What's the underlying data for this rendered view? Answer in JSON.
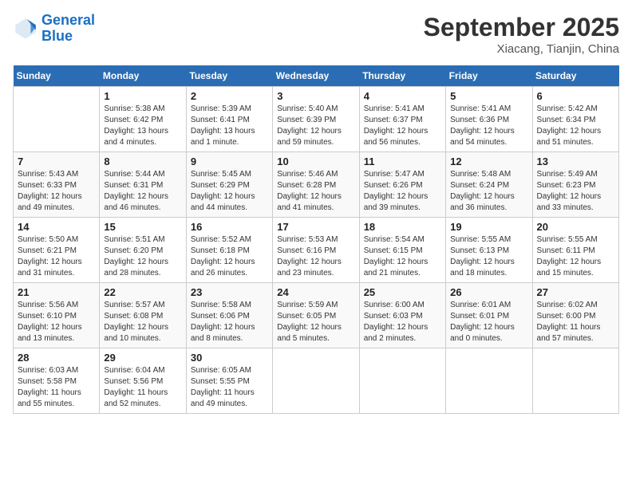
{
  "header": {
    "logo_line1": "General",
    "logo_line2": "Blue",
    "month_title": "September 2025",
    "location": "Xiacang, Tianjin, China"
  },
  "days_of_week": [
    "Sunday",
    "Monday",
    "Tuesday",
    "Wednesday",
    "Thursday",
    "Friday",
    "Saturday"
  ],
  "weeks": [
    [
      {
        "num": "",
        "info": ""
      },
      {
        "num": "1",
        "info": "Sunrise: 5:38 AM\nSunset: 6:42 PM\nDaylight: 13 hours\nand 4 minutes."
      },
      {
        "num": "2",
        "info": "Sunrise: 5:39 AM\nSunset: 6:41 PM\nDaylight: 13 hours\nand 1 minute."
      },
      {
        "num": "3",
        "info": "Sunrise: 5:40 AM\nSunset: 6:39 PM\nDaylight: 12 hours\nand 59 minutes."
      },
      {
        "num": "4",
        "info": "Sunrise: 5:41 AM\nSunset: 6:37 PM\nDaylight: 12 hours\nand 56 minutes."
      },
      {
        "num": "5",
        "info": "Sunrise: 5:41 AM\nSunset: 6:36 PM\nDaylight: 12 hours\nand 54 minutes."
      },
      {
        "num": "6",
        "info": "Sunrise: 5:42 AM\nSunset: 6:34 PM\nDaylight: 12 hours\nand 51 minutes."
      }
    ],
    [
      {
        "num": "7",
        "info": "Sunrise: 5:43 AM\nSunset: 6:33 PM\nDaylight: 12 hours\nand 49 minutes."
      },
      {
        "num": "8",
        "info": "Sunrise: 5:44 AM\nSunset: 6:31 PM\nDaylight: 12 hours\nand 46 minutes."
      },
      {
        "num": "9",
        "info": "Sunrise: 5:45 AM\nSunset: 6:29 PM\nDaylight: 12 hours\nand 44 minutes."
      },
      {
        "num": "10",
        "info": "Sunrise: 5:46 AM\nSunset: 6:28 PM\nDaylight: 12 hours\nand 41 minutes."
      },
      {
        "num": "11",
        "info": "Sunrise: 5:47 AM\nSunset: 6:26 PM\nDaylight: 12 hours\nand 39 minutes."
      },
      {
        "num": "12",
        "info": "Sunrise: 5:48 AM\nSunset: 6:24 PM\nDaylight: 12 hours\nand 36 minutes."
      },
      {
        "num": "13",
        "info": "Sunrise: 5:49 AM\nSunset: 6:23 PM\nDaylight: 12 hours\nand 33 minutes."
      }
    ],
    [
      {
        "num": "14",
        "info": "Sunrise: 5:50 AM\nSunset: 6:21 PM\nDaylight: 12 hours\nand 31 minutes."
      },
      {
        "num": "15",
        "info": "Sunrise: 5:51 AM\nSunset: 6:20 PM\nDaylight: 12 hours\nand 28 minutes."
      },
      {
        "num": "16",
        "info": "Sunrise: 5:52 AM\nSunset: 6:18 PM\nDaylight: 12 hours\nand 26 minutes."
      },
      {
        "num": "17",
        "info": "Sunrise: 5:53 AM\nSunset: 6:16 PM\nDaylight: 12 hours\nand 23 minutes."
      },
      {
        "num": "18",
        "info": "Sunrise: 5:54 AM\nSunset: 6:15 PM\nDaylight: 12 hours\nand 21 minutes."
      },
      {
        "num": "19",
        "info": "Sunrise: 5:55 AM\nSunset: 6:13 PM\nDaylight: 12 hours\nand 18 minutes."
      },
      {
        "num": "20",
        "info": "Sunrise: 5:55 AM\nSunset: 6:11 PM\nDaylight: 12 hours\nand 15 minutes."
      }
    ],
    [
      {
        "num": "21",
        "info": "Sunrise: 5:56 AM\nSunset: 6:10 PM\nDaylight: 12 hours\nand 13 minutes."
      },
      {
        "num": "22",
        "info": "Sunrise: 5:57 AM\nSunset: 6:08 PM\nDaylight: 12 hours\nand 10 minutes."
      },
      {
        "num": "23",
        "info": "Sunrise: 5:58 AM\nSunset: 6:06 PM\nDaylight: 12 hours\nand 8 minutes."
      },
      {
        "num": "24",
        "info": "Sunrise: 5:59 AM\nSunset: 6:05 PM\nDaylight: 12 hours\nand 5 minutes."
      },
      {
        "num": "25",
        "info": "Sunrise: 6:00 AM\nSunset: 6:03 PM\nDaylight: 12 hours\nand 2 minutes."
      },
      {
        "num": "26",
        "info": "Sunrise: 6:01 AM\nSunset: 6:01 PM\nDaylight: 12 hours\nand 0 minutes."
      },
      {
        "num": "27",
        "info": "Sunrise: 6:02 AM\nSunset: 6:00 PM\nDaylight: 11 hours\nand 57 minutes."
      }
    ],
    [
      {
        "num": "28",
        "info": "Sunrise: 6:03 AM\nSunset: 5:58 PM\nDaylight: 11 hours\nand 55 minutes."
      },
      {
        "num": "29",
        "info": "Sunrise: 6:04 AM\nSunset: 5:56 PM\nDaylight: 11 hours\nand 52 minutes."
      },
      {
        "num": "30",
        "info": "Sunrise: 6:05 AM\nSunset: 5:55 PM\nDaylight: 11 hours\nand 49 minutes."
      },
      {
        "num": "",
        "info": ""
      },
      {
        "num": "",
        "info": ""
      },
      {
        "num": "",
        "info": ""
      },
      {
        "num": "",
        "info": ""
      }
    ]
  ]
}
